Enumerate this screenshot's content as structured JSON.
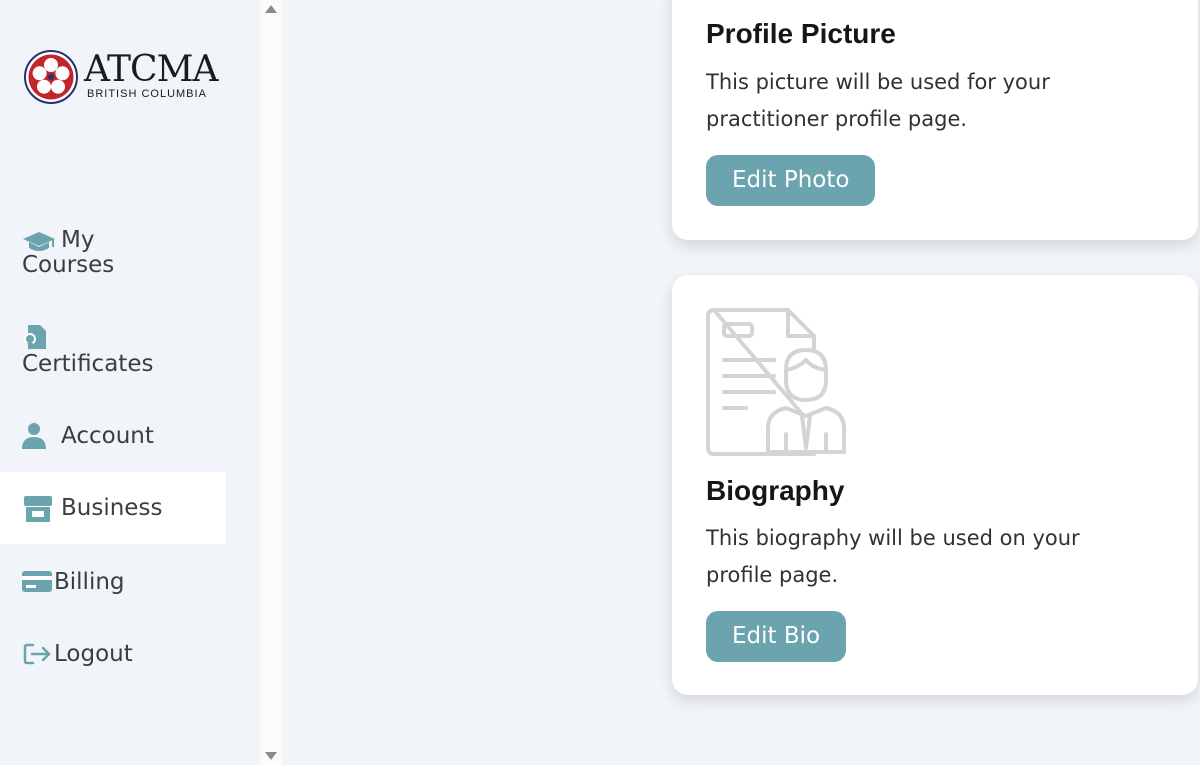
{
  "logo": {
    "title": "ATCMA",
    "subtitle": "BRITISH COLUMBIA"
  },
  "sidebar": {
    "items": [
      {
        "label_line1": "My",
        "label_line2": "Courses",
        "icon": "graduation-cap-icon"
      },
      {
        "label": "Certificates",
        "icon": "certificate-icon"
      },
      {
        "label": "Account",
        "icon": "user-icon"
      },
      {
        "label": "Business",
        "icon": "store-icon",
        "active": true
      },
      {
        "label": "Billing",
        "icon": "credit-card-icon"
      },
      {
        "label": "Logout",
        "icon": "logout-icon"
      }
    ]
  },
  "cards": {
    "profile": {
      "title": "Profile Picture",
      "description": "This picture will be used for your practitioner profile page.",
      "button": "Edit Photo"
    },
    "bio": {
      "title": "Biography",
      "description": "This biography will be used on your profile page.",
      "button": "Edit Bio",
      "illustration": "biography-document-person-icon"
    }
  },
  "colors": {
    "accent": "#6ba3ae",
    "background": "#f1f4f8",
    "card": "#ffffff",
    "logo_red": "#c0272d",
    "logo_navy": "#2b2f6b"
  }
}
